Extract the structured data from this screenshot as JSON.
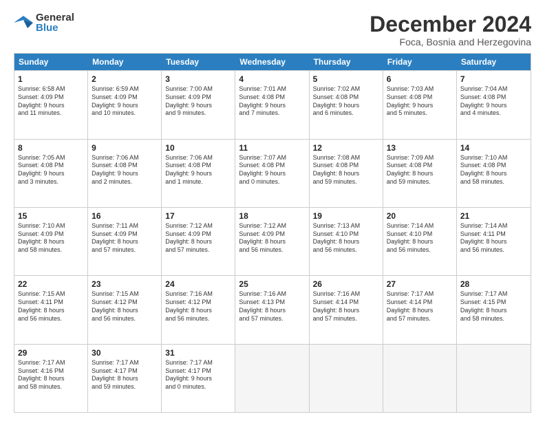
{
  "logo": {
    "general": "General",
    "blue": "Blue"
  },
  "title": "December 2024",
  "subtitle": "Foca, Bosnia and Herzegovina",
  "days": [
    "Sunday",
    "Monday",
    "Tuesday",
    "Wednesday",
    "Thursday",
    "Friday",
    "Saturday"
  ],
  "weeks": [
    [
      {
        "day": "1",
        "info": "Sunrise: 6:58 AM\nSunset: 4:09 PM\nDaylight: 9 hours\nand 11 minutes."
      },
      {
        "day": "2",
        "info": "Sunrise: 6:59 AM\nSunset: 4:09 PM\nDaylight: 9 hours\nand 10 minutes."
      },
      {
        "day": "3",
        "info": "Sunrise: 7:00 AM\nSunset: 4:09 PM\nDaylight: 9 hours\nand 9 minutes."
      },
      {
        "day": "4",
        "info": "Sunrise: 7:01 AM\nSunset: 4:08 PM\nDaylight: 9 hours\nand 7 minutes."
      },
      {
        "day": "5",
        "info": "Sunrise: 7:02 AM\nSunset: 4:08 PM\nDaylight: 9 hours\nand 6 minutes."
      },
      {
        "day": "6",
        "info": "Sunrise: 7:03 AM\nSunset: 4:08 PM\nDaylight: 9 hours\nand 5 minutes."
      },
      {
        "day": "7",
        "info": "Sunrise: 7:04 AM\nSunset: 4:08 PM\nDaylight: 9 hours\nand 4 minutes."
      }
    ],
    [
      {
        "day": "8",
        "info": "Sunrise: 7:05 AM\nSunset: 4:08 PM\nDaylight: 9 hours\nand 3 minutes."
      },
      {
        "day": "9",
        "info": "Sunrise: 7:06 AM\nSunset: 4:08 PM\nDaylight: 9 hours\nand 2 minutes."
      },
      {
        "day": "10",
        "info": "Sunrise: 7:06 AM\nSunset: 4:08 PM\nDaylight: 9 hours\nand 1 minute."
      },
      {
        "day": "11",
        "info": "Sunrise: 7:07 AM\nSunset: 4:08 PM\nDaylight: 9 hours\nand 0 minutes."
      },
      {
        "day": "12",
        "info": "Sunrise: 7:08 AM\nSunset: 4:08 PM\nDaylight: 8 hours\nand 59 minutes."
      },
      {
        "day": "13",
        "info": "Sunrise: 7:09 AM\nSunset: 4:08 PM\nDaylight: 8 hours\nand 59 minutes."
      },
      {
        "day": "14",
        "info": "Sunrise: 7:10 AM\nSunset: 4:08 PM\nDaylight: 8 hours\nand 58 minutes."
      }
    ],
    [
      {
        "day": "15",
        "info": "Sunrise: 7:10 AM\nSunset: 4:09 PM\nDaylight: 8 hours\nand 58 minutes."
      },
      {
        "day": "16",
        "info": "Sunrise: 7:11 AM\nSunset: 4:09 PM\nDaylight: 8 hours\nand 57 minutes."
      },
      {
        "day": "17",
        "info": "Sunrise: 7:12 AM\nSunset: 4:09 PM\nDaylight: 8 hours\nand 57 minutes."
      },
      {
        "day": "18",
        "info": "Sunrise: 7:12 AM\nSunset: 4:09 PM\nDaylight: 8 hours\nand 56 minutes."
      },
      {
        "day": "19",
        "info": "Sunrise: 7:13 AM\nSunset: 4:10 PM\nDaylight: 8 hours\nand 56 minutes."
      },
      {
        "day": "20",
        "info": "Sunrise: 7:14 AM\nSunset: 4:10 PM\nDaylight: 8 hours\nand 56 minutes."
      },
      {
        "day": "21",
        "info": "Sunrise: 7:14 AM\nSunset: 4:11 PM\nDaylight: 8 hours\nand 56 minutes."
      }
    ],
    [
      {
        "day": "22",
        "info": "Sunrise: 7:15 AM\nSunset: 4:11 PM\nDaylight: 8 hours\nand 56 minutes."
      },
      {
        "day": "23",
        "info": "Sunrise: 7:15 AM\nSunset: 4:12 PM\nDaylight: 8 hours\nand 56 minutes."
      },
      {
        "day": "24",
        "info": "Sunrise: 7:16 AM\nSunset: 4:12 PM\nDaylight: 8 hours\nand 56 minutes."
      },
      {
        "day": "25",
        "info": "Sunrise: 7:16 AM\nSunset: 4:13 PM\nDaylight: 8 hours\nand 57 minutes."
      },
      {
        "day": "26",
        "info": "Sunrise: 7:16 AM\nSunset: 4:14 PM\nDaylight: 8 hours\nand 57 minutes."
      },
      {
        "day": "27",
        "info": "Sunrise: 7:17 AM\nSunset: 4:14 PM\nDaylight: 8 hours\nand 57 minutes."
      },
      {
        "day": "28",
        "info": "Sunrise: 7:17 AM\nSunset: 4:15 PM\nDaylight: 8 hours\nand 58 minutes."
      }
    ],
    [
      {
        "day": "29",
        "info": "Sunrise: 7:17 AM\nSunset: 4:16 PM\nDaylight: 8 hours\nand 58 minutes."
      },
      {
        "day": "30",
        "info": "Sunrise: 7:17 AM\nSunset: 4:17 PM\nDaylight: 8 hours\nand 59 minutes."
      },
      {
        "day": "31",
        "info": "Sunrise: 7:17 AM\nSunset: 4:17 PM\nDaylight: 9 hours\nand 0 minutes."
      },
      {
        "day": "",
        "info": ""
      },
      {
        "day": "",
        "info": ""
      },
      {
        "day": "",
        "info": ""
      },
      {
        "day": "",
        "info": ""
      }
    ]
  ]
}
